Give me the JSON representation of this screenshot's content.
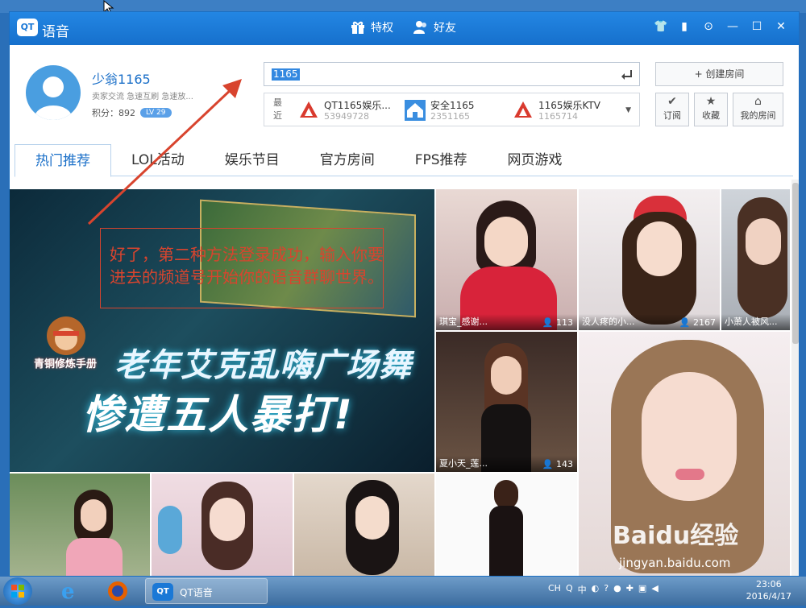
{
  "window": {
    "app_name": "语音",
    "logo_text": "QT",
    "center_links": [
      {
        "label": "特权",
        "icon": "gift-icon"
      },
      {
        "label": "好友",
        "icon": "friends-icon"
      }
    ],
    "controls": [
      "skin-icon",
      "message-icon",
      "settings-icon",
      "minimize-icon",
      "maximize-icon",
      "close-icon"
    ]
  },
  "profile": {
    "username": "少翁1165",
    "tags": "卖家交流 急速互刷 急速放...",
    "points_label": "积分：892",
    "level": "LV 29"
  },
  "search": {
    "value": "1165"
  },
  "recent": {
    "label": "最近",
    "items": [
      {
        "title": "QT1165娱乐...",
        "id": "53949728"
      },
      {
        "title": "安全1165",
        "id": "2351165"
      },
      {
        "title": "1165娱乐KTV",
        "id": "1165714"
      }
    ]
  },
  "buttons": {
    "create_room": "+ 创建房间",
    "subscribe": "订阅",
    "favorite": "收藏",
    "my_room": "我的房间"
  },
  "tabs": [
    "热门推荐",
    "LOL活动",
    "娱乐节目",
    "官方房间",
    "FPS推荐",
    "网页游戏"
  ],
  "banner": {
    "line1": "老年艾克乱嗨广场舞",
    "line2": "惨遭五人暴打!",
    "badge": "青铜修炼手册"
  },
  "annotation": {
    "text": "好了，第二种方法登录成功，输入你要进去的频道号开始你的语音群聊世界。"
  },
  "cards": [
    {
      "name": "琪宝_感谢...",
      "viewers": "113"
    },
    {
      "name": "没人疼的小...",
      "viewers": "2167"
    },
    {
      "name": "小萧人被风...",
      "viewers": ""
    },
    {
      "name": "夏小天_莲...",
      "viewers": "143"
    }
  ],
  "watermark": {
    "brand": "Baidu经验",
    "url": "jingyan.baidu.com"
  },
  "taskbar": {
    "task_label": "QT语音",
    "tray_lang": "CH",
    "tray_ime": "中",
    "time": "23:06",
    "date": "2016/4/17"
  }
}
